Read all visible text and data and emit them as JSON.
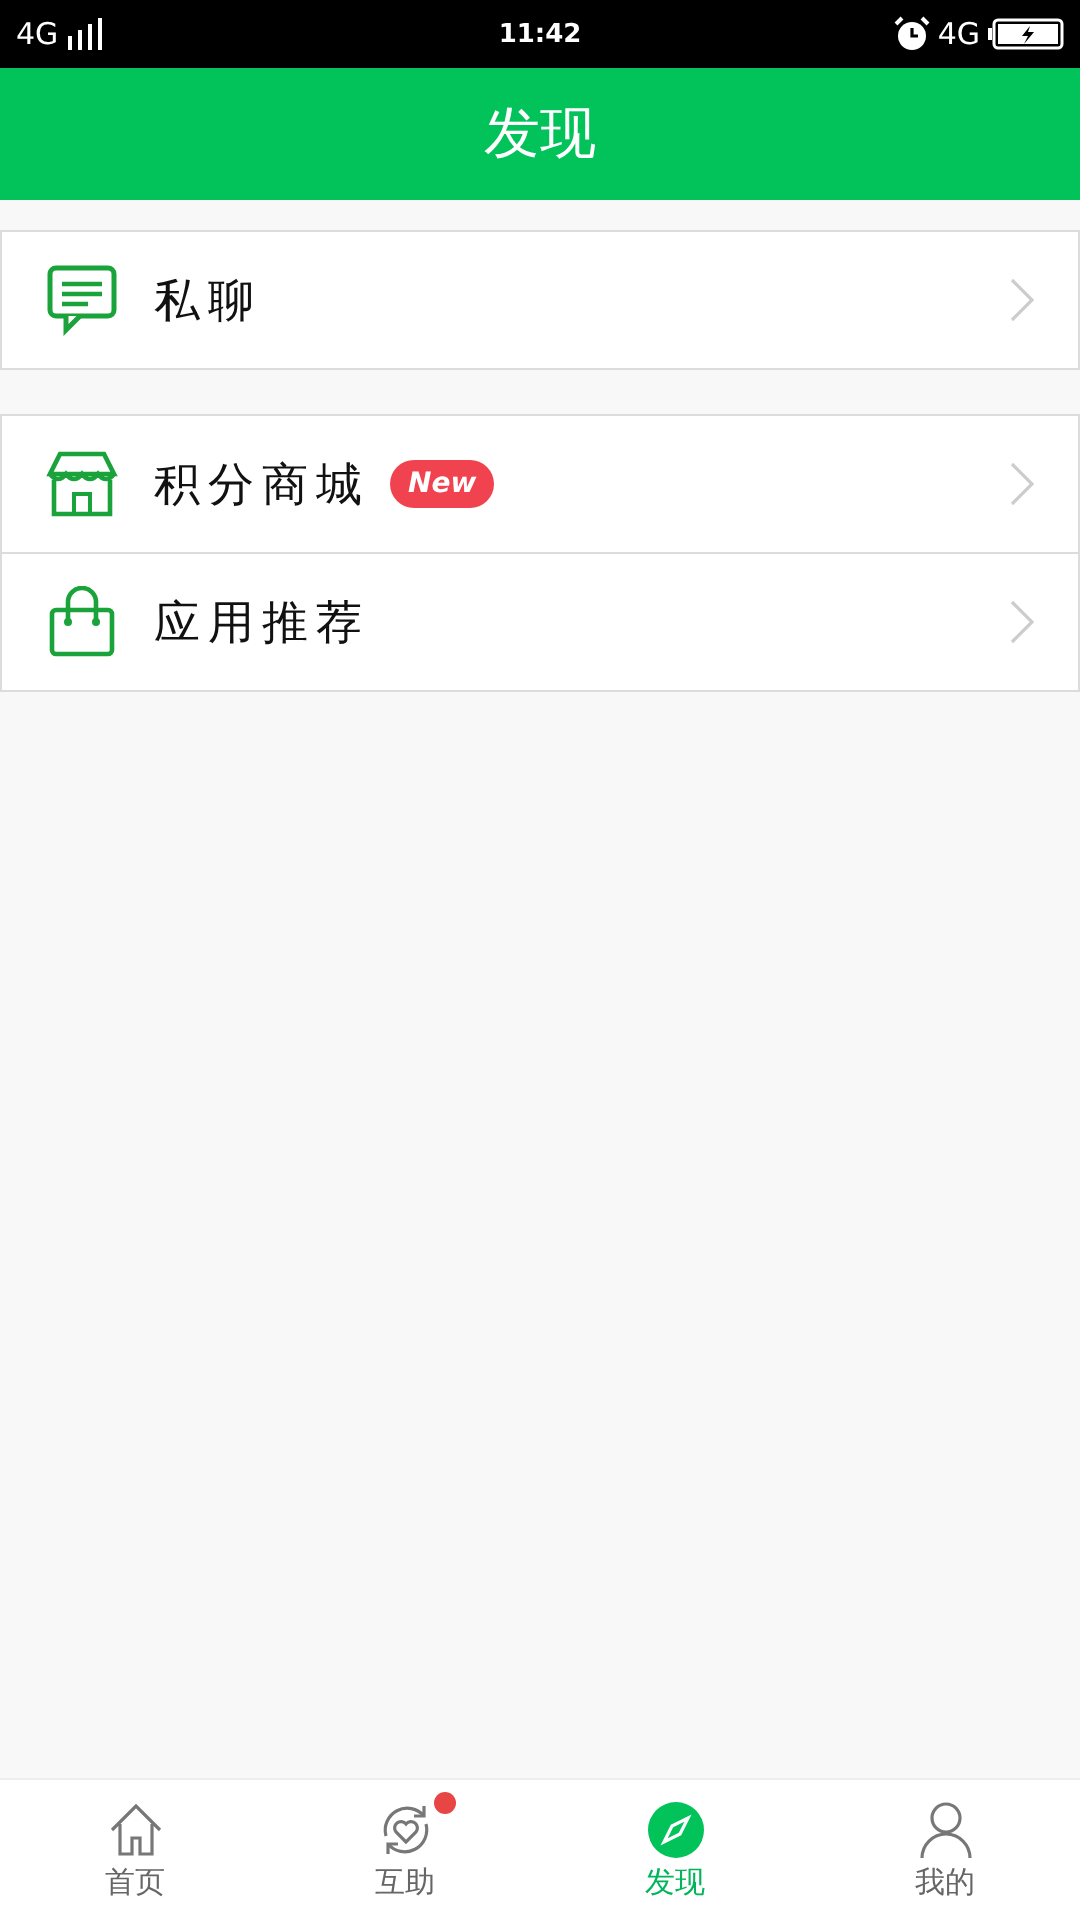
{
  "status_bar": {
    "network_left": "4G",
    "time": "11:42",
    "network_right": "4G"
  },
  "header": {
    "title": "发现"
  },
  "groups": [
    {
      "items": [
        {
          "kind": "chat",
          "label": "私聊"
        }
      ]
    },
    {
      "items": [
        {
          "kind": "store",
          "label": "积分商城",
          "badge": "New"
        },
        {
          "kind": "bag",
          "label": "应用推荐"
        }
      ]
    }
  ],
  "tab_bar": [
    {
      "kind": "home",
      "label": "首页",
      "selected": false,
      "dot": false
    },
    {
      "kind": "help",
      "label": "互助",
      "selected": false,
      "dot": true
    },
    {
      "kind": "discover",
      "label": "发现",
      "selected": true,
      "dot": false
    },
    {
      "kind": "me",
      "label": "我的",
      "selected": false,
      "dot": false
    }
  ]
}
